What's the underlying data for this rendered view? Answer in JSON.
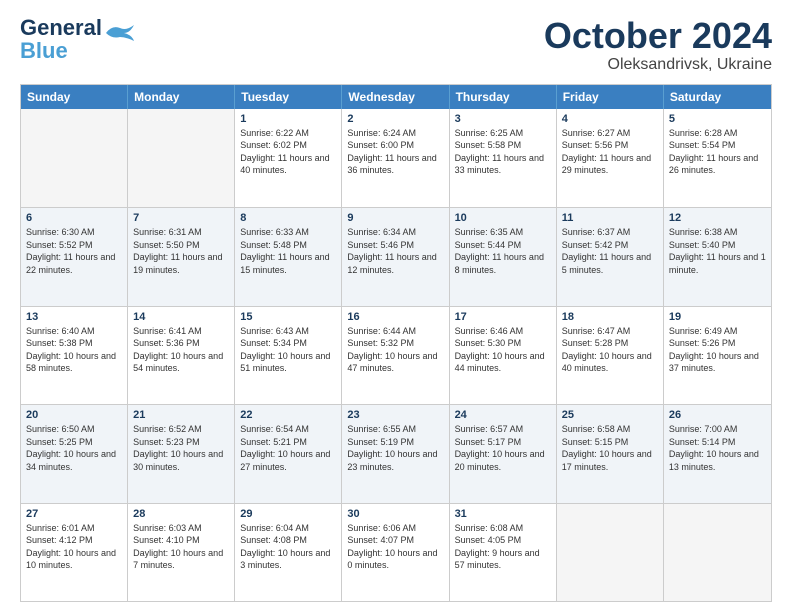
{
  "header": {
    "logo_line1": "General",
    "logo_line2": "Blue",
    "month": "October 2024",
    "location": "Oleksandrivsk, Ukraine"
  },
  "weekdays": [
    "Sunday",
    "Monday",
    "Tuesday",
    "Wednesday",
    "Thursday",
    "Friday",
    "Saturday"
  ],
  "weeks": [
    [
      {
        "day": "",
        "info": "",
        "empty": true
      },
      {
        "day": "",
        "info": "",
        "empty": true
      },
      {
        "day": "1",
        "info": "Sunrise: 6:22 AM\nSunset: 6:02 PM\nDaylight: 11 hours and 40 minutes."
      },
      {
        "day": "2",
        "info": "Sunrise: 6:24 AM\nSunset: 6:00 PM\nDaylight: 11 hours and 36 minutes."
      },
      {
        "day": "3",
        "info": "Sunrise: 6:25 AM\nSunset: 5:58 PM\nDaylight: 11 hours and 33 minutes."
      },
      {
        "day": "4",
        "info": "Sunrise: 6:27 AM\nSunset: 5:56 PM\nDaylight: 11 hours and 29 minutes."
      },
      {
        "day": "5",
        "info": "Sunrise: 6:28 AM\nSunset: 5:54 PM\nDaylight: 11 hours and 26 minutes."
      }
    ],
    [
      {
        "day": "6",
        "info": "Sunrise: 6:30 AM\nSunset: 5:52 PM\nDaylight: 11 hours and 22 minutes."
      },
      {
        "day": "7",
        "info": "Sunrise: 6:31 AM\nSunset: 5:50 PM\nDaylight: 11 hours and 19 minutes."
      },
      {
        "day": "8",
        "info": "Sunrise: 6:33 AM\nSunset: 5:48 PM\nDaylight: 11 hours and 15 minutes."
      },
      {
        "day": "9",
        "info": "Sunrise: 6:34 AM\nSunset: 5:46 PM\nDaylight: 11 hours and 12 minutes."
      },
      {
        "day": "10",
        "info": "Sunrise: 6:35 AM\nSunset: 5:44 PM\nDaylight: 11 hours and 8 minutes."
      },
      {
        "day": "11",
        "info": "Sunrise: 6:37 AM\nSunset: 5:42 PM\nDaylight: 11 hours and 5 minutes."
      },
      {
        "day": "12",
        "info": "Sunrise: 6:38 AM\nSunset: 5:40 PM\nDaylight: 11 hours and 1 minute."
      }
    ],
    [
      {
        "day": "13",
        "info": "Sunrise: 6:40 AM\nSunset: 5:38 PM\nDaylight: 10 hours and 58 minutes."
      },
      {
        "day": "14",
        "info": "Sunrise: 6:41 AM\nSunset: 5:36 PM\nDaylight: 10 hours and 54 minutes."
      },
      {
        "day": "15",
        "info": "Sunrise: 6:43 AM\nSunset: 5:34 PM\nDaylight: 10 hours and 51 minutes."
      },
      {
        "day": "16",
        "info": "Sunrise: 6:44 AM\nSunset: 5:32 PM\nDaylight: 10 hours and 47 minutes."
      },
      {
        "day": "17",
        "info": "Sunrise: 6:46 AM\nSunset: 5:30 PM\nDaylight: 10 hours and 44 minutes."
      },
      {
        "day": "18",
        "info": "Sunrise: 6:47 AM\nSunset: 5:28 PM\nDaylight: 10 hours and 40 minutes."
      },
      {
        "day": "19",
        "info": "Sunrise: 6:49 AM\nSunset: 5:26 PM\nDaylight: 10 hours and 37 minutes."
      }
    ],
    [
      {
        "day": "20",
        "info": "Sunrise: 6:50 AM\nSunset: 5:25 PM\nDaylight: 10 hours and 34 minutes."
      },
      {
        "day": "21",
        "info": "Sunrise: 6:52 AM\nSunset: 5:23 PM\nDaylight: 10 hours and 30 minutes."
      },
      {
        "day": "22",
        "info": "Sunrise: 6:54 AM\nSunset: 5:21 PM\nDaylight: 10 hours and 27 minutes."
      },
      {
        "day": "23",
        "info": "Sunrise: 6:55 AM\nSunset: 5:19 PM\nDaylight: 10 hours and 23 minutes."
      },
      {
        "day": "24",
        "info": "Sunrise: 6:57 AM\nSunset: 5:17 PM\nDaylight: 10 hours and 20 minutes."
      },
      {
        "day": "25",
        "info": "Sunrise: 6:58 AM\nSunset: 5:15 PM\nDaylight: 10 hours and 17 minutes."
      },
      {
        "day": "26",
        "info": "Sunrise: 7:00 AM\nSunset: 5:14 PM\nDaylight: 10 hours and 13 minutes."
      }
    ],
    [
      {
        "day": "27",
        "info": "Sunrise: 6:01 AM\nSunset: 4:12 PM\nDaylight: 10 hours and 10 minutes."
      },
      {
        "day": "28",
        "info": "Sunrise: 6:03 AM\nSunset: 4:10 PM\nDaylight: 10 hours and 7 minutes."
      },
      {
        "day": "29",
        "info": "Sunrise: 6:04 AM\nSunset: 4:08 PM\nDaylight: 10 hours and 3 minutes."
      },
      {
        "day": "30",
        "info": "Sunrise: 6:06 AM\nSunset: 4:07 PM\nDaylight: 10 hours and 0 minutes."
      },
      {
        "day": "31",
        "info": "Sunrise: 6:08 AM\nSunset: 4:05 PM\nDaylight: 9 hours and 57 minutes."
      },
      {
        "day": "",
        "info": "",
        "empty": true
      },
      {
        "day": "",
        "info": "",
        "empty": true
      }
    ]
  ]
}
